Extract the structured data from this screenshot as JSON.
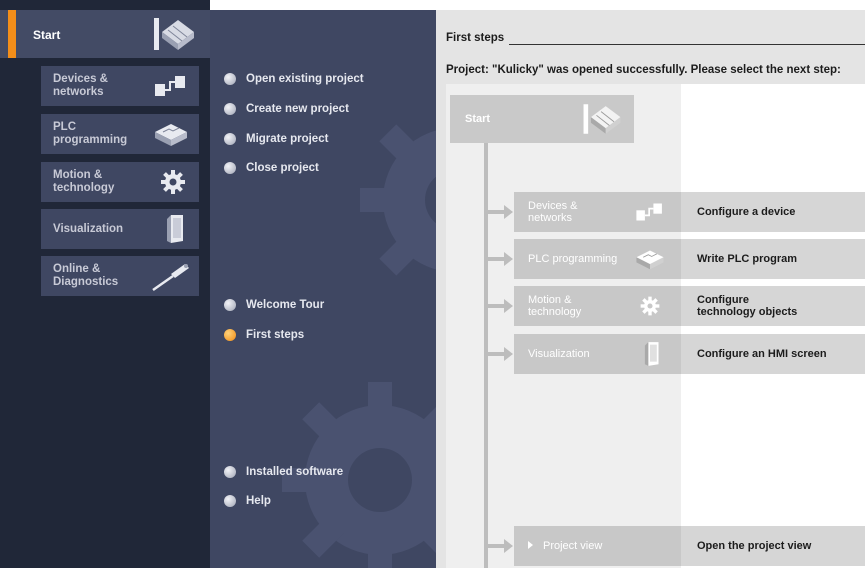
{
  "portal": {
    "start": {
      "label": "Start",
      "icon": "start-icon"
    },
    "items": [
      {
        "label": "Devices & networks",
        "line1": "Devices &",
        "line2": "networks",
        "icon": "devices-networks-icon"
      },
      {
        "label": "PLC programming",
        "line1": "PLC",
        "line2": "programming",
        "icon": "plc-programming-icon"
      },
      {
        "label": "Motion & technology",
        "line1": "Motion &",
        "line2": "technology",
        "icon": "motion-gear-icon"
      },
      {
        "label": "Visualization",
        "line1": "Visualization",
        "line2": "",
        "icon": "visualization-panel-icon"
      },
      {
        "label": "Online & Diagnostics",
        "line1": "Online &",
        "line2": "Diagnostics",
        "icon": "diagnostics-probe-icon"
      }
    ]
  },
  "nav": {
    "top": [
      "Open existing project",
      "Create new project",
      "Migrate project",
      "Close project"
    ],
    "middle": [
      "Welcome Tour",
      "First steps"
    ],
    "bottom": [
      "Installed software",
      "Help"
    ],
    "active": "First steps"
  },
  "content": {
    "title": "First steps",
    "message": "Project: \"Kulicky\" was opened successfully. Please select the next step:",
    "flow_start": "Start",
    "steps": [
      {
        "line1": "Devices &",
        "line2": "networks",
        "desc1": "Configure a device",
        "desc2": ""
      },
      {
        "line1": "PLC programming",
        "line2": "",
        "desc1": "Write PLC program",
        "desc2": ""
      },
      {
        "line1": "Motion &",
        "line2": "technology",
        "desc1": "Configure",
        "desc2": "technology objects"
      },
      {
        "line1": "Visualization",
        "line2": "",
        "desc1": "Configure an HMI screen",
        "desc2": ""
      }
    ],
    "project_view": {
      "label": "Project view",
      "desc": "Open the project view"
    }
  },
  "colors": {
    "portal_bg": "#202738",
    "portal_button": "#3f4762",
    "accent": "#f38e1a",
    "content_bg": "#e4e4e4",
    "flow_button": "#c8c8c8",
    "description": "#d6d6d6"
  }
}
